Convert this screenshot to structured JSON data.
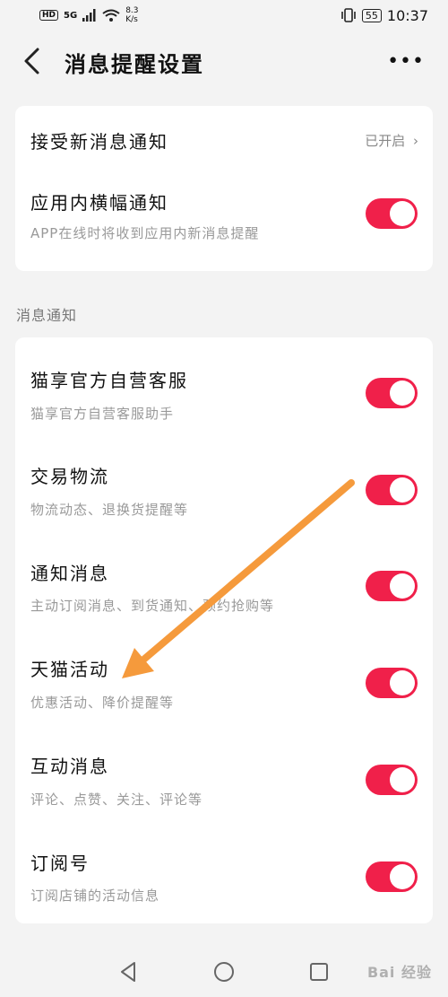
{
  "status_bar": {
    "hd": "HD",
    "signal": "5G",
    "net_speed_value": "8.3",
    "net_speed_unit": "K/s",
    "battery": "55",
    "time": "10:37"
  },
  "header": {
    "title": "消息提醒设置"
  },
  "top_card": {
    "receive": {
      "title": "接受新消息通知",
      "status": "已开启"
    },
    "banner": {
      "title": "应用内横幅通知",
      "subtitle": "APP在线时将收到应用内新消息提醒",
      "on": true
    }
  },
  "section_label": "消息通知",
  "notifications": [
    {
      "title": "猫享官方自营客服",
      "subtitle": "猫享官方自营客服助手",
      "on": true
    },
    {
      "title": "交易物流",
      "subtitle": "物流动态、退换货提醒等",
      "on": true
    },
    {
      "title": "通知消息",
      "subtitle": "主动订阅消息、到货通知、预约抢购等",
      "on": true
    },
    {
      "title": "天猫活动",
      "subtitle": "优惠活动、降价提醒等",
      "on": true
    },
    {
      "title": "互动消息",
      "subtitle": "评论、点赞、关注、评论等",
      "on": true
    },
    {
      "title": "订阅号",
      "subtitle": "订阅店铺的活动信息",
      "on": true
    }
  ],
  "watermark": "Bai 经验",
  "colors": {
    "toggle_on": "#f0204a",
    "arrow": "#f59a3c"
  }
}
